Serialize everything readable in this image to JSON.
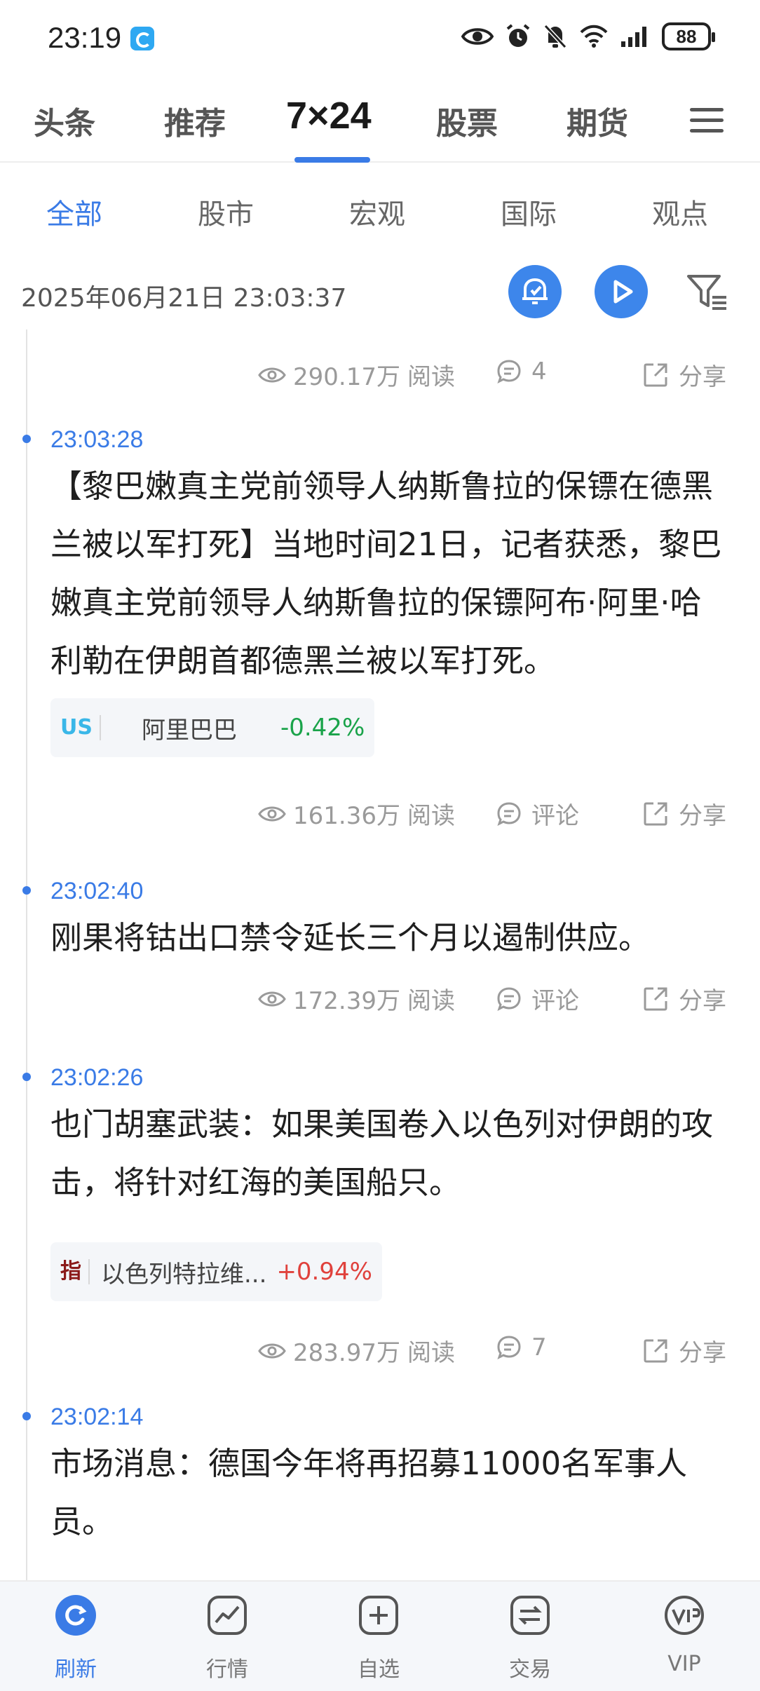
{
  "status_bar": {
    "time": "23:19",
    "battery": "88"
  },
  "main_tabs": [
    {
      "label": "头条"
    },
    {
      "label": "推荐"
    },
    {
      "label": "7×24"
    },
    {
      "label": "股票"
    },
    {
      "label": "期货"
    }
  ],
  "sub_tabs": [
    {
      "label": "全部"
    },
    {
      "label": "股市"
    },
    {
      "label": "宏观"
    },
    {
      "label": "国际"
    },
    {
      "label": "观点"
    }
  ],
  "date_bar": {
    "datetime": "2025年06月21日 23:03:37"
  },
  "feed": {
    "partial_item": {
      "views": "290.17万",
      "views_label": "阅读",
      "comments": "4",
      "share": "分享"
    },
    "items": [
      {
        "time": "23:03:28",
        "text": "【黎巴嫩真主党前领导人纳斯鲁拉的保镖在德黑兰被以军打死】当地时间21日，记者获悉，黎巴嫩真主党前领导人纳斯鲁拉的保镖阿布·阿里·哈利勒在伊朗首都德黑兰被以军打死。",
        "stock": {
          "market": "US",
          "name": "阿里巴巴",
          "change": "-0.42%"
        },
        "views": "161.36万",
        "views_label": "阅读",
        "comments": "评论",
        "share": "分享"
      },
      {
        "time": "23:02:40",
        "text": "刚果将钴出口禁令延长三个月以遏制供应。",
        "views": "172.39万",
        "views_label": "阅读",
        "comments": "评论",
        "share": "分享"
      },
      {
        "time": "23:02:26",
        "text": "也门胡塞武装：如果美国卷入以色列对伊朗的攻击，将针对红海的美国船只。",
        "stock": {
          "market": "指",
          "name": "以色列特拉维...",
          "change": "+0.94%"
        },
        "views": "283.97万",
        "views_label": "阅读",
        "comments": "7",
        "share": "分享"
      },
      {
        "time": "23:02:14",
        "text": "市场消息：德国今年将再招募11000名军事人员。"
      }
    ]
  },
  "bottom_nav": [
    {
      "label": "刷新",
      "icon": "refresh-icon"
    },
    {
      "label": "行情",
      "icon": "market-chart-icon"
    },
    {
      "label": "自选",
      "icon": "add-favorite-icon"
    },
    {
      "label": "交易",
      "icon": "trade-swap-icon"
    },
    {
      "label": "VIP",
      "icon": "vip-icon"
    }
  ],
  "colors": {
    "accent": "#3a7be6",
    "down": "#1aa34a",
    "up": "#e0413c",
    "us_badge": "#3ab7e8",
    "index_badge": "#8b1a1a"
  }
}
